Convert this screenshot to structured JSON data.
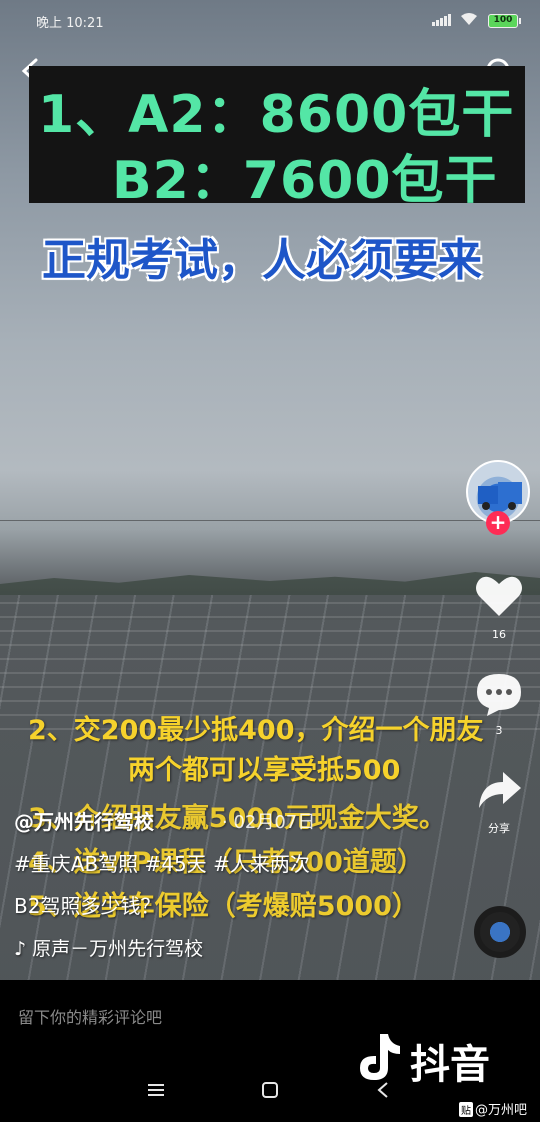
{
  "status_bar": {
    "time": "晚上 10:21",
    "battery": "100"
  },
  "video": {
    "headline_line1": "1、A2：8600包干",
    "headline_line2": "B2：7600包干",
    "subtitle": "正规考试，人必须要来",
    "promo_lines": [
      "2、交200最少抵400，介绍一个朋友",
      "两个都可以享受抵500",
      "3、介绍朋友赢5000元现金大奖。",
      "4、送VIP课程（只考500道题）",
      "5、送学车保险（考爆赔5000）"
    ]
  },
  "post": {
    "author": "@万州先行驾校",
    "date": "· 02月07日",
    "tags": "#重庆AB驾照 #45天 #人来两次",
    "description": "B2驾照多少钱？",
    "music": "♪ 原声－万州先行驾校"
  },
  "rail": {
    "likes": "16",
    "comments": "3",
    "share_label": "分享"
  },
  "comment_placeholder": "留下你的精彩评论吧",
  "brand": "抖音",
  "watermark": {
    "badge": "贴",
    "text": "@万州吧"
  },
  "colors": {
    "headline": "#54e6a6",
    "subtitle": "#1e56c8",
    "promo": "#f6d22c",
    "follow": "#fe2c55"
  }
}
